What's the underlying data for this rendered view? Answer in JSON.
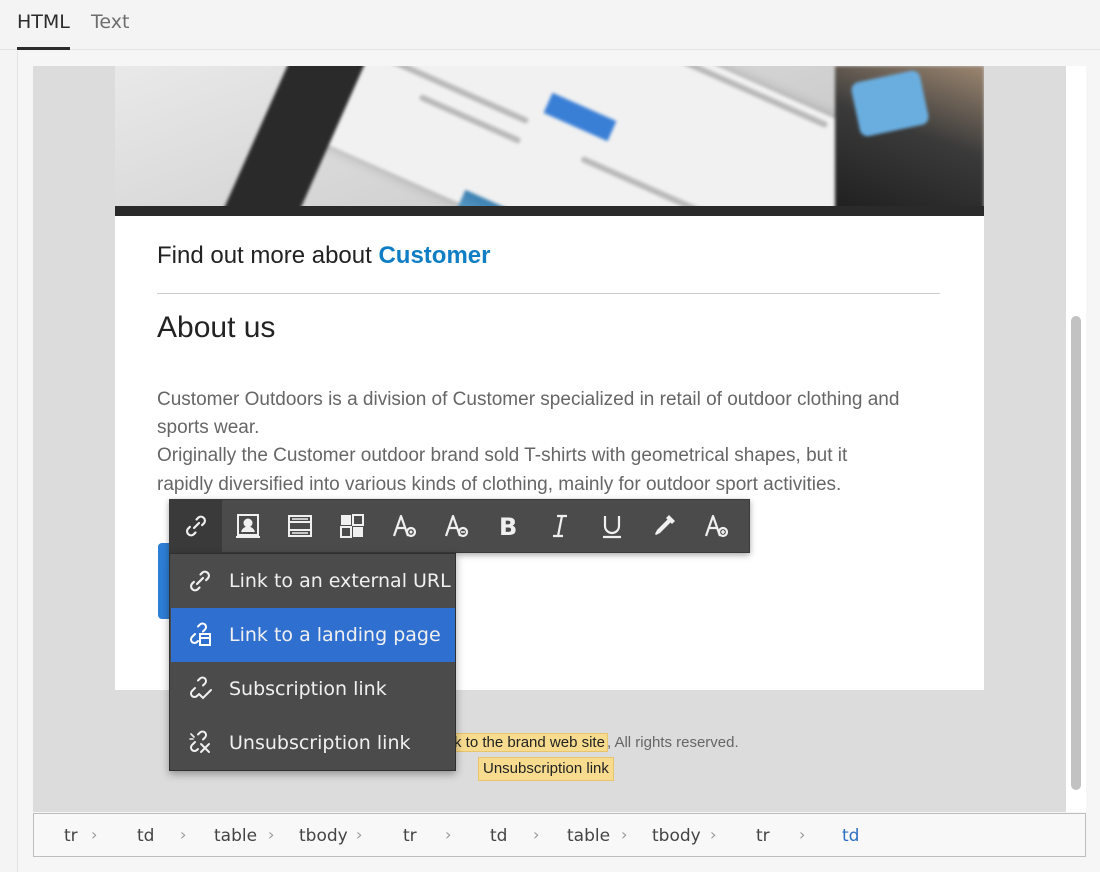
{
  "tabs": [
    {
      "label": "HTML",
      "active": true
    },
    {
      "label": "Text",
      "active": false
    }
  ],
  "email": {
    "find_more_prefix": "Find out more about ",
    "find_more_brand": "Customer",
    "heading": "About us",
    "paragraph_lines": [
      "Customer Outdoors is a division of Customer specialized in retail of outdoor clothing and",
      "sports wear.",
      "Originally the Customer outdoor brand sold T-shirts with geometrical shapes, but it",
      "rapidly diversified into various kinds of clothing, mainly for outdoor sport activities."
    ],
    "footer": {
      "brand_link_fragment": "k to the brand web site",
      "rights": ", All rights reserved.",
      "unsubscription": "Unsubscription link"
    },
    "hero_image": {
      "description_icons": [
        "tablet-mockup-image"
      ],
      "brand_color": "#0f7ec4"
    }
  },
  "toolbar": {
    "buttons": [
      {
        "name": "link",
        "icon": "link-icon",
        "active": true
      },
      {
        "name": "personalization",
        "icon": "personalization-icon"
      },
      {
        "name": "insert-content",
        "icon": "content-block-icon"
      },
      {
        "name": "insert-fragment",
        "icon": "fragment-icon"
      },
      {
        "name": "font",
        "icon": "font-icon"
      },
      {
        "name": "font-options",
        "icon": "font-options-icon"
      },
      {
        "name": "bold",
        "icon": "bold-icon"
      },
      {
        "name": "italic",
        "icon": "italic-icon"
      },
      {
        "name": "underline",
        "icon": "underline-icon"
      },
      {
        "name": "color-picker",
        "icon": "eyedropper-icon"
      },
      {
        "name": "text-style",
        "icon": "text-style-icon"
      }
    ]
  },
  "link_menu": {
    "items": [
      {
        "label": "Link to an external URL",
        "icon": "link-icon",
        "selected": false
      },
      {
        "label": "Link to a landing page",
        "icon": "landing-page-link-icon",
        "selected": true
      },
      {
        "label": "Subscription link",
        "icon": "subscription-link-icon",
        "selected": false
      },
      {
        "label": "Unsubscription link",
        "icon": "unsubscription-link-icon",
        "selected": false
      }
    ]
  },
  "breadcrumb": {
    "items": [
      "tr",
      "td",
      "table",
      "tbody",
      "tr",
      "td",
      "table",
      "tbody",
      "tr",
      "td"
    ],
    "current_index": 9,
    "separator": "›"
  },
  "colors": {
    "accent": "#2f6fcf",
    "brand": "#0f7ec4",
    "highlight": "#f7dc8f",
    "toolbar_bg": "#4b4b4b"
  }
}
